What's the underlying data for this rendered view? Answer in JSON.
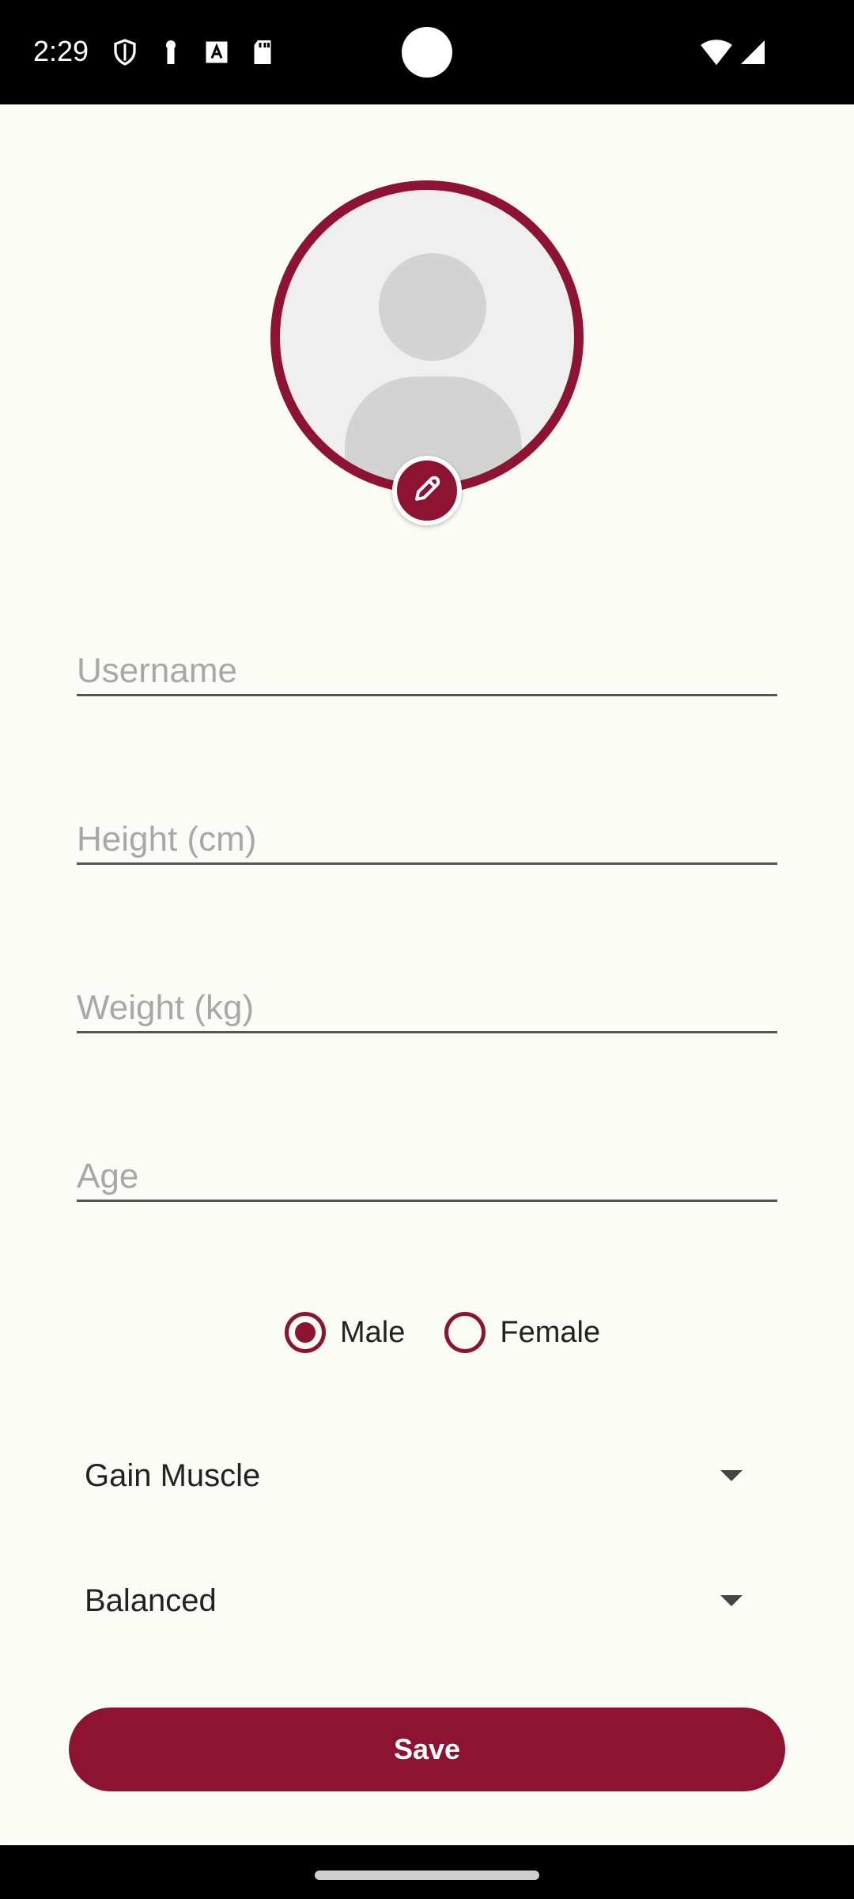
{
  "status_bar": {
    "time": "2:29",
    "icons_left": [
      "shield-icon",
      "key-icon",
      "font-icon",
      "sd-card-icon"
    ],
    "icons_right": [
      "wifi-icon",
      "signal-icon"
    ]
  },
  "profile": {
    "avatar_icon": "default-avatar-icon",
    "edit_icon": "pencil-icon"
  },
  "form": {
    "username": {
      "placeholder": "Username",
      "value": ""
    },
    "height": {
      "placeholder": "Height (cm)",
      "value": ""
    },
    "weight": {
      "placeholder": "Weight (kg)",
      "value": ""
    },
    "age": {
      "placeholder": "Age",
      "value": ""
    },
    "gender": {
      "options": [
        {
          "label": "Male",
          "checked": true
        },
        {
          "label": "Female",
          "checked": false
        }
      ]
    },
    "goal": {
      "selected": "Gain Muscle"
    },
    "diet": {
      "selected": "Balanced"
    },
    "save_label": "Save"
  },
  "colors": {
    "accent": "#8e1332",
    "background": "#fcfcf7",
    "avatar_bg": "#efefef",
    "avatar_fg": "#d3d3d3"
  }
}
